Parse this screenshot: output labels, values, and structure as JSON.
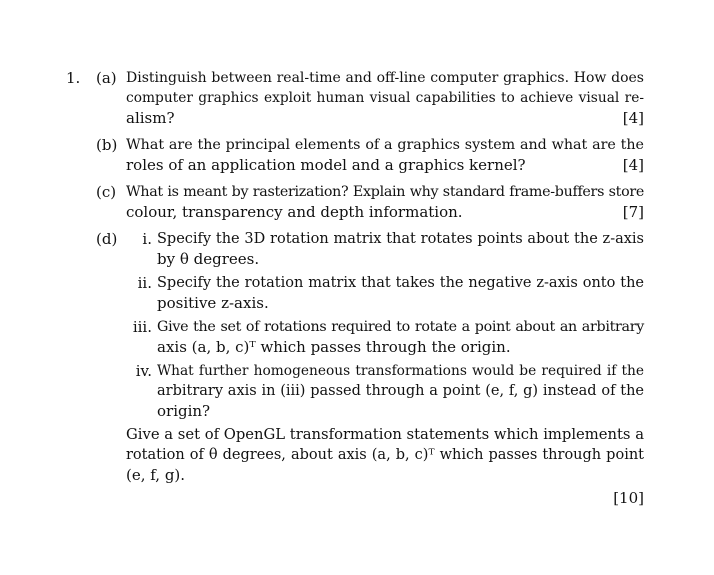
{
  "question": {
    "number": "1.",
    "parts": {
      "a": {
        "label": "(a)",
        "lines": [
          "Distinguish between real-time and off-line computer graphics. How does",
          "computer graphics exploit human visual capabilities to achieve visual re-",
          "alism?"
        ],
        "mark": "[4]"
      },
      "b": {
        "label": "(b)",
        "lines": [
          "What are the principal elements of a graphics system and what are the",
          "roles of an application model and a graphics kernel?"
        ],
        "mark": "[4]"
      },
      "c": {
        "label": "(c)",
        "lines": [
          "What is meant by rasterization? Explain why standard frame-buffers store",
          "colour, transparency and depth information."
        ],
        "mark": "[7]"
      },
      "d": {
        "label": "(d)",
        "subparts": [
          {
            "label": "i.",
            "lines": [
              "Specify the 3D rotation matrix that rotates points about the z-axis",
              "by θ degrees."
            ]
          },
          {
            "label": "ii.",
            "lines": [
              "Specify the rotation matrix that takes the negative z-axis onto the",
              "positive z-axis."
            ]
          },
          {
            "label": "iii.",
            "lines": [
              "Give the set of rotations required to rotate a point about an arbitrary",
              "axis (a, b, c)ᵀ which passes through the origin."
            ]
          },
          {
            "label": "iv.",
            "lines": [
              "What further homogeneous transformations would be required if the",
              "arbitrary axis in (iii) passed through a point (e, f, g) instead of the",
              "origin?"
            ]
          }
        ],
        "closing_lines": [
          "Give a set of OpenGL transformation statements which implements a",
          "rotation of θ degrees, about axis (a, b, c)ᵀ which passes through point",
          "(e, f, g)."
        ],
        "mark": "[10]"
      }
    }
  }
}
